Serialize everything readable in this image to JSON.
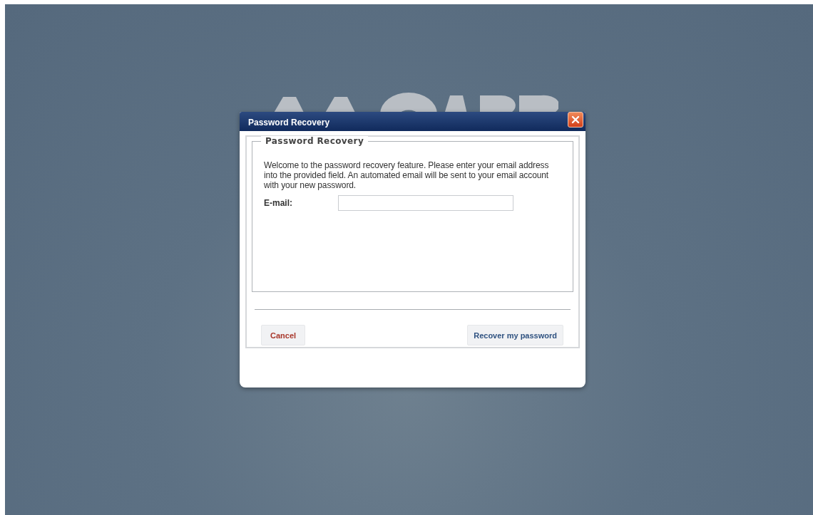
{
  "dialog": {
    "title": "Password Recovery",
    "form": {
      "legend": "Password Recovery",
      "message": "Welcome to the password recovery feature. Please enter your email address into the provided field. An automated email will be sent to your email account with your new password.",
      "fields": [
        {
          "label": "E-mail:"
        }
      ]
    },
    "buttons": [
      {
        "label": "Cancel",
        "kind": "cancel"
      },
      {
        "label": "Recover my password",
        "kind": "primary"
      }
    ]
  }
}
